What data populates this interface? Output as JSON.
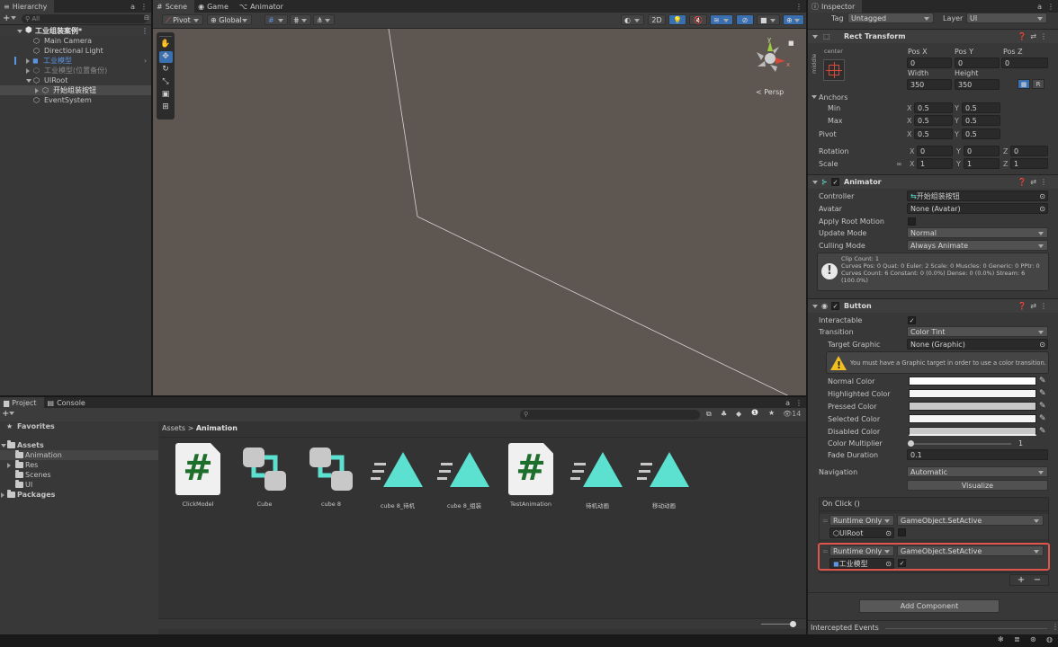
{
  "hierarchy": {
    "tab": "Hierarchy",
    "lock": "a",
    "search_placeholder": "All",
    "items": [
      {
        "label": "工业组装案例*"
      },
      {
        "label": "Main Camera"
      },
      {
        "label": "Directional Light"
      },
      {
        "label": "工业模型"
      },
      {
        "label": "工业模型(位置备份)"
      },
      {
        "label": "UIRoot"
      },
      {
        "label": "开始组装按钮"
      },
      {
        "label": "EventSystem"
      }
    ]
  },
  "scene_tabs": {
    "scene": "Scene",
    "game": "Game",
    "animator": "Animator"
  },
  "scene_toolbar": {
    "pivot": "Pivot",
    "global": "Global",
    "mode_2d": "2D"
  },
  "scene_view": {
    "persp": "< Persp",
    "gizmo_y": "y",
    "gizmo_x": "x"
  },
  "project": {
    "tab_project": "Project",
    "tab_console": "Console",
    "favorites": "Favorites",
    "assets": "Assets",
    "folders": [
      "Animation",
      "Res",
      "Scenes",
      "UI"
    ],
    "packages": "Packages",
    "breadcrumb_root": "Assets",
    "breadcrumb_sep": ">",
    "breadcrumb_current": "Animation",
    "hidden_count": "14",
    "files": [
      {
        "name": "ClickModel",
        "icon": "script-icon"
      },
      {
        "name": "Cube",
        "icon": "animator-controller-icon"
      },
      {
        "name": "cube 8",
        "icon": "animator-controller-icon"
      },
      {
        "name": "cube 8_待机",
        "icon": "animation-clip-icon"
      },
      {
        "name": "cube 8_组装",
        "icon": "animation-clip-icon"
      },
      {
        "name": "TestAnimation",
        "icon": "script-icon"
      },
      {
        "name": "待机动画",
        "icon": "animation-clip-icon"
      },
      {
        "name": "移动动画",
        "icon": "animation-clip-icon"
      }
    ]
  },
  "inspector": {
    "tab": "Inspector",
    "tag_label": "Tag",
    "tag_value": "Untagged",
    "layer_label": "Layer",
    "layer_value": "UI",
    "rect_transform": {
      "title": "Rect Transform",
      "anchor_preset_top": "center",
      "anchor_preset_side": "middle",
      "headers": [
        "Pos X",
        "Pos Y",
        "Pos Z"
      ],
      "pos": [
        "0",
        "0",
        "0"
      ],
      "width_label": "Width",
      "height_label": "Height",
      "width": "350",
      "height": "350",
      "raw_button": "R",
      "anchors_label": "Anchors",
      "min_label": "Min",
      "max_label": "Max",
      "min": [
        "0.5",
        "0.5"
      ],
      "max": [
        "0.5",
        "0.5"
      ],
      "pivot_label": "Pivot",
      "pivot": [
        "0.5",
        "0.5"
      ],
      "rotation_label": "Rotation",
      "rotation": [
        "0",
        "0",
        "0"
      ],
      "scale_label": "Scale",
      "scale": [
        "1",
        "1",
        "1"
      ]
    },
    "animator": {
      "title": "Animator",
      "controller_label": "Controller",
      "controller_value": "开始组装按钮",
      "avatar_label": "Avatar",
      "avatar_value": "None (Avatar)",
      "apply_root_motion_label": "Apply Root Motion",
      "update_mode_label": "Update Mode",
      "update_mode_value": "Normal",
      "culling_mode_label": "Culling Mode",
      "culling_mode_value": "Always Animate",
      "info_line1": "Clip Count: 1",
      "info_line2": "Curves Pos: 0 Quat: 0 Euler: 2 Scale: 0 Muscles: 0 Generic: 0 PPtr: 0",
      "info_line3": "Curves Count: 6 Constant: 0 (0.0%) Dense: 0 (0.0%) Stream: 6",
      "info_line4": "(100.0%)"
    },
    "button": {
      "title": "Button",
      "interactable_label": "Interactable",
      "transition_label": "Transition",
      "transition_value": "Color Tint",
      "target_graphic_label": "Target Graphic",
      "target_graphic_value": "None (Graphic)",
      "warning": "You must have a Graphic target in order to use a color transition.",
      "normal_color_label": "Normal Color",
      "highlighted_color_label": "Highlighted Color",
      "pressed_color_label": "Pressed Color",
      "selected_color_label": "Selected Color",
      "disabled_color_label": "Disabled Color",
      "color_multiplier_label": "Color Multiplier",
      "color_multiplier_value": "1",
      "fade_duration_label": "Fade Duration",
      "fade_duration_value": "0.1",
      "navigation_label": "Navigation",
      "navigation_value": "Automatic",
      "visualize_button": "Visualize",
      "onclick_title": "On Click ()",
      "events": [
        {
          "runtime": "Runtime Only",
          "function": "GameObject.SetActive",
          "object": "UIRoot",
          "checked": false
        },
        {
          "runtime": "Runtime Only",
          "function": "GameObject.SetActive",
          "object": "工业模型",
          "checked": true
        }
      ],
      "add_remove": "+   −"
    },
    "add_component": "Add Component",
    "intercepted_events": "Intercepted Events"
  },
  "colors": {
    "highlight_outline": "#e0554a",
    "selection_blue": "#3a6fb0",
    "anim_clip": "#5ce0d0"
  }
}
